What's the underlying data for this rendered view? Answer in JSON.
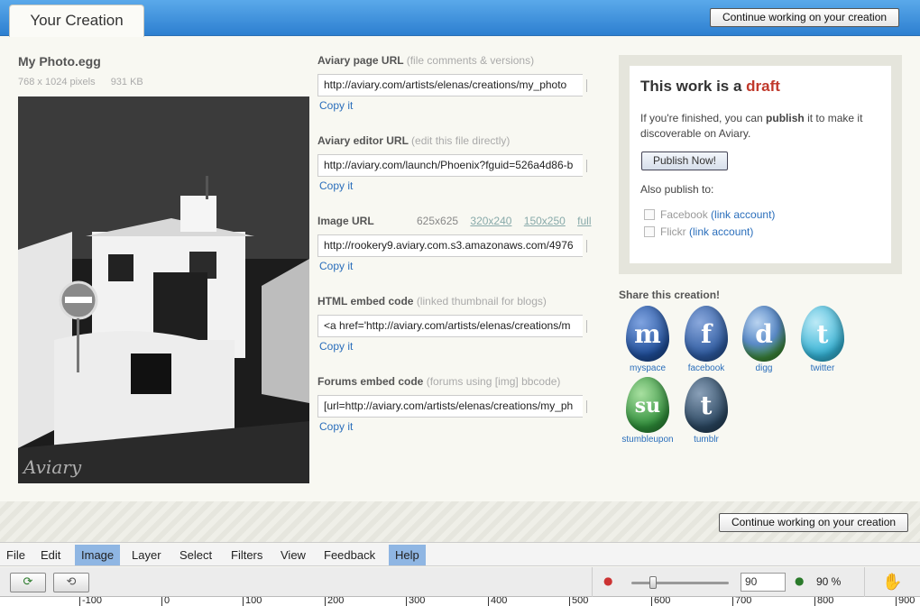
{
  "header": {
    "tab_label": "Your Creation",
    "continue_label": "Continue working on your creation"
  },
  "file": {
    "name": "My Photo.egg",
    "dimensions": "768 x 1024 pixels",
    "size": "931 KB",
    "watermark": "Aviary"
  },
  "fields": [
    {
      "label": "Aviary page URL",
      "hint": "(file comments & versions)",
      "value": "http://aviary.com/artists/elenas/creations/my_photo",
      "copy": "Copy it"
    },
    {
      "label": "Aviary editor URL",
      "hint": "(edit this file directly)",
      "value": "http://aviary.com/launch/Phoenix?fguid=526a4d86-b",
      "copy": "Copy it"
    },
    {
      "label": "Image URL",
      "hint": "",
      "value": "http://rookery9.aviary.com.s3.amazonaws.com/4976",
      "copy": "Copy it"
    },
    {
      "label": "HTML embed code",
      "hint": "(linked thumbnail for blogs)",
      "value": "<a href='http://aviary.com/artists/elenas/creations/m",
      "copy": "Copy it"
    },
    {
      "label": "Forums embed code",
      "hint": "(forums using [img] bbcode)",
      "value": "[url=http://aviary.com/artists/elenas/creations/my_ph",
      "copy": "Copy it"
    }
  ],
  "image_sizes": {
    "current": "625x625",
    "options": [
      "320x240",
      "150x250",
      "full"
    ]
  },
  "draft": {
    "title_prefix": "This work is a",
    "title_status": "draft",
    "text_before": "If you're finished, you can",
    "text_bold": "publish",
    "text_after": "it to make it discoverable on Aviary.",
    "publish_label": "Publish Now!",
    "also_publish": "Also publish to:",
    "services": [
      {
        "name": "Facebook",
        "link": "(link account)"
      },
      {
        "name": "Flickr",
        "link": "(link account)"
      }
    ]
  },
  "share": {
    "title": "Share this creation!",
    "items": [
      {
        "label": "myspace",
        "glyph": "m",
        "color": "#1f4e9a",
        "icon": "myspace-icon"
      },
      {
        "label": "facebook",
        "glyph": "f",
        "color": "#2d5aa0",
        "icon": "facebook-icon"
      },
      {
        "label": "digg",
        "glyph": "d",
        "color": "#3d8a3a",
        "icon": "digg-icon"
      },
      {
        "label": "twitter",
        "glyph": "t",
        "color": "#34b3d6",
        "icon": "twitter-icon"
      },
      {
        "label": "stumbleupon",
        "glyph": "su",
        "color": "#2f8f3a",
        "icon": "stumbleupon-icon"
      },
      {
        "label": "tumblr",
        "glyph": "t",
        "color": "#2a4660",
        "icon": "tumblr-icon"
      }
    ]
  },
  "menu": [
    "File",
    "Edit",
    "Image",
    "Layer",
    "Select",
    "Filters",
    "View",
    "Feedback",
    "Help"
  ],
  "menu_active": [
    "Image",
    "Help"
  ],
  "zoom": {
    "input_value": "90",
    "percent_label": "90 %",
    "level": 0.2
  },
  "ruler": [
    "-100",
    "0",
    "100",
    "200",
    "300",
    "400",
    "500",
    "600",
    "700",
    "800",
    "900"
  ]
}
